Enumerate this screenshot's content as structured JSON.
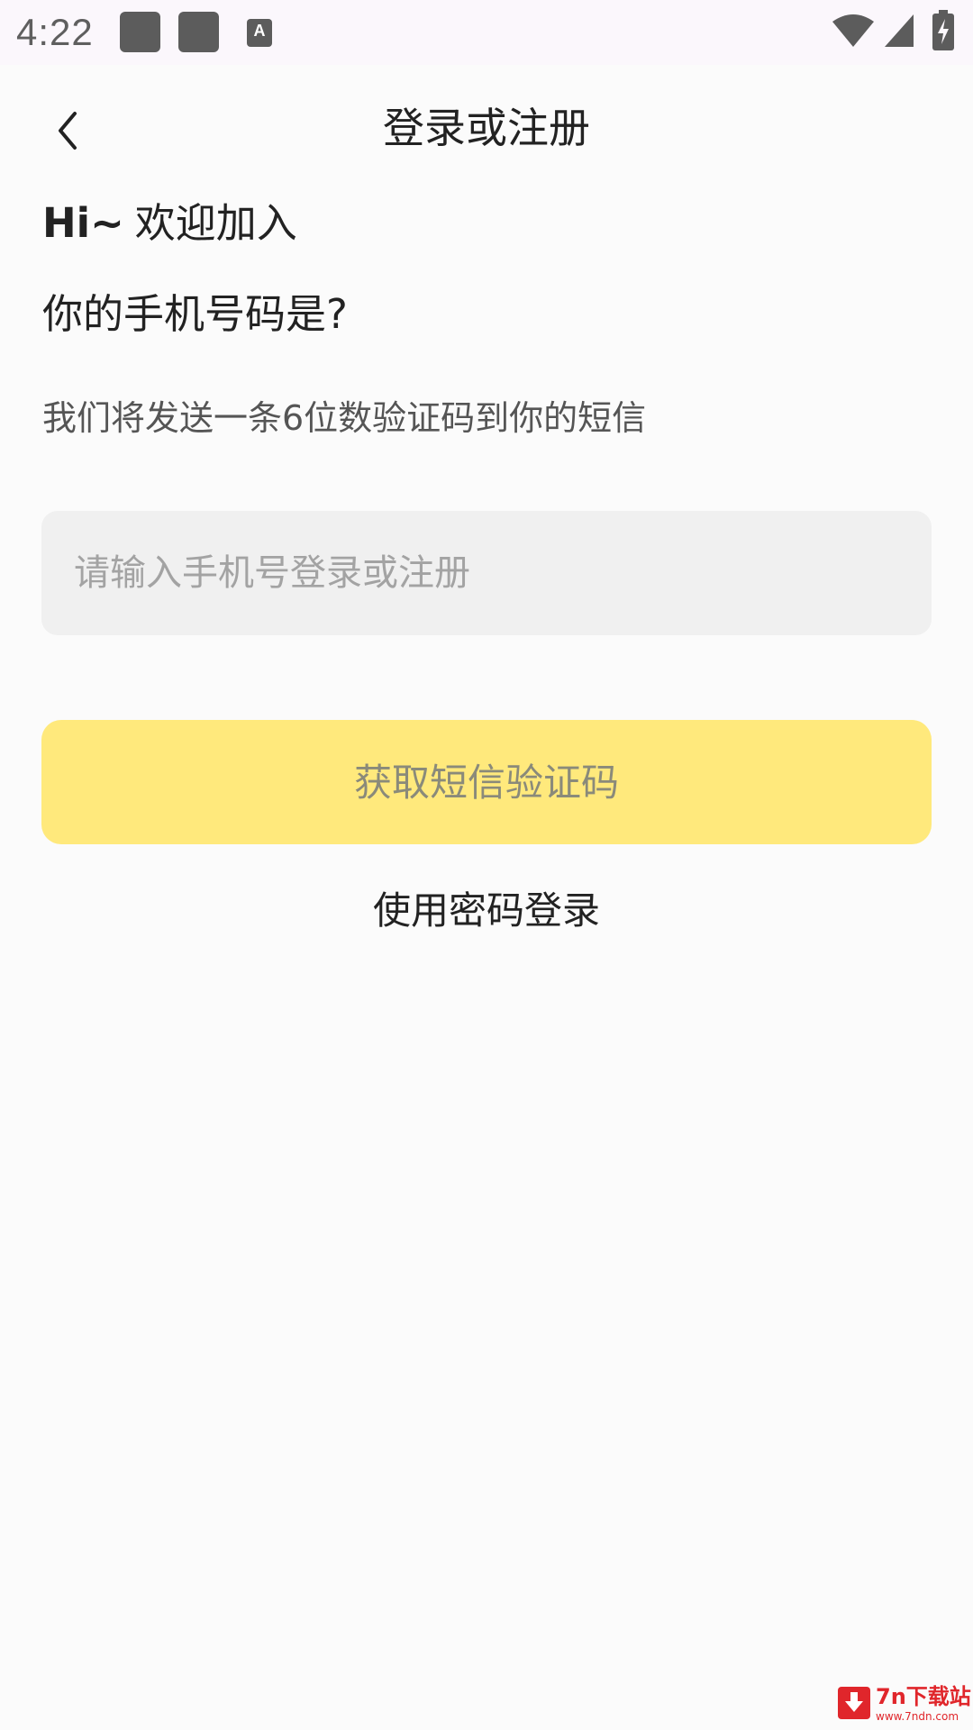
{
  "status_bar": {
    "time": "4:22",
    "notification_label": "A",
    "icons": [
      "wifi-icon",
      "signal-icon",
      "battery-charging-icon"
    ]
  },
  "app_bar": {
    "title": "登录或注册",
    "back_icon": "chevron-left-icon"
  },
  "content": {
    "greeting_hi": "Hi~",
    "greeting_text": "欢迎加入",
    "question": "你的手机号码是?",
    "hint": "我们将发送一条6位数验证码到你的短信",
    "phone_input": {
      "value": "",
      "placeholder": "请输入手机号登录或注册"
    },
    "sms_button_label": "获取短信验证码",
    "password_login_label": "使用密码登录"
  },
  "watermark": {
    "brand": "7n下载站",
    "url": "www.7ndn.com"
  },
  "colors": {
    "background": "#fbfbfb",
    "status_bar": "#fbf7fc",
    "input_background": "#f0f0f0",
    "button_yellow": "#ffe97c",
    "button_text": "#8a8a7a",
    "watermark_red": "#e0262b"
  }
}
